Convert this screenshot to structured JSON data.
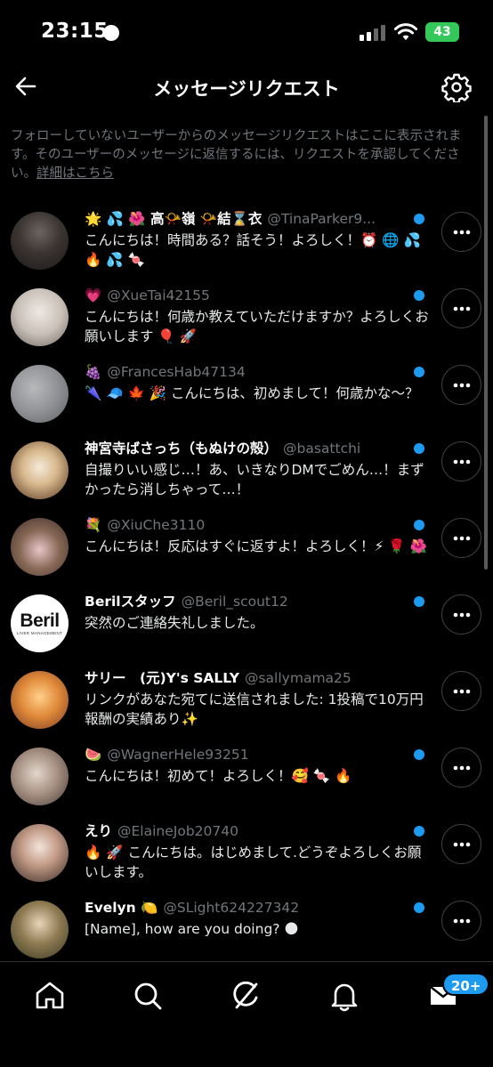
{
  "status_bar": {
    "time": "23:15",
    "battery": "43"
  },
  "header": {
    "title": "メッセージリクエスト"
  },
  "description": {
    "text": "フォローしていないユーザーからのメッセージリクエストはここに表示されます。そのユーザーのメッセージに返信するには、リクエストを承認してください。",
    "link": "詳細はこちら"
  },
  "requests": [
    {
      "name": "🌟 💦 🌺 高📯嶺 📯結⌛衣",
      "handle": "@TinaParker9...",
      "message": "こんにちは！時間ある？話そう！よろしく！⏰ 🌐 💦 🔥 💦 🍬"
    },
    {
      "name": "💗",
      "handle": "@XueTai42155",
      "message": "こんにちは！何歳か教えていただけますか？よろしくお願いします 🎈 🚀"
    },
    {
      "name": "🍇",
      "handle": "@FrancesHab47134",
      "message": "🌂 🧢 🍁 🎉 こんにちは、初めまして！何歳かな～？"
    },
    {
      "name": "神宮寺ばさっち（もぬけの殻）",
      "handle": "@basattchi",
      "message": "自撮りいい感じ…！あ、いきなりDMでごめん…！まずかったら消しちゃって…！"
    },
    {
      "name": "💐",
      "handle": "@XiuChe3110",
      "message": "こんにちは！反応はすぐに返すよ！よろしく！⚡ 🌹 🌺"
    },
    {
      "name": "Berilスタッフ",
      "handle": "@Beril_scout12",
      "message": "突然のご連絡失礼しました。"
    },
    {
      "name": "サリー　(元)Y's SALLY",
      "handle": "@sallymama25",
      "message": "リンクがあなた宛てに送信されました: 1投稿で10万円報酬の実績あり✨"
    },
    {
      "name": "🍉",
      "handle": "@WagnerHele93251",
      "message": "こんにちは！初めて！よろしく！🥰 🍬 🔥"
    },
    {
      "name": "えり",
      "handle": "@ElaineJob20740",
      "message": "🔥 🚀 こんにちは。はじめまして.どうぞよろしくお願いします。"
    },
    {
      "name": "Evelyn 🍋",
      "handle": "@SLight624227342",
      "message": "[Name], how are you doing? 🌑"
    }
  ],
  "beril_logo": {
    "word": "Beril",
    "tagline": "LIVER MANAGEMENT"
  },
  "nav": {
    "messages_badge": "20+"
  },
  "colors": {
    "accent": "#1d9bf0",
    "background": "#000000",
    "secondary_text": "#71767b",
    "battery": "#34c759"
  },
  "icons": {
    "back": "arrow-left-icon",
    "settings": "gear-icon",
    "more": "ellipsis-icon",
    "home": "home-icon",
    "search": "search-icon",
    "grok": "slash-circle-icon",
    "notifications": "bell-icon",
    "messages": "envelope-icon"
  }
}
